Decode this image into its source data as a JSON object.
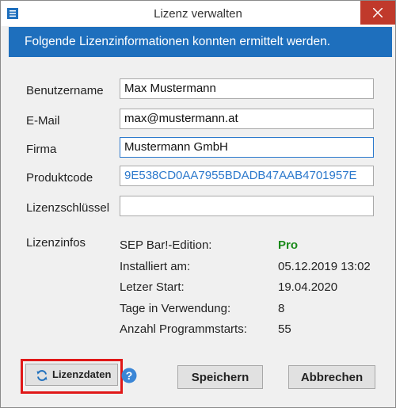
{
  "window": {
    "title": "Lizenz verwalten",
    "banner": "Folgende Lizenzinformationen konnten ermittelt werden."
  },
  "form": {
    "username_label": "Benutzername",
    "username_value": "Max Mustermann",
    "email_label": "E-Mail",
    "email_value": "max@mustermann.at",
    "company_label": "Firma",
    "company_value": "Mustermann GmbH",
    "product_code_label": "Produktcode",
    "product_code_value": "9E538CD0AA7955BDADB47AAB4701957E",
    "license_key_label": "Lizenzschlüssel",
    "license_key_value": ""
  },
  "license_info": {
    "section_label": "Lizenzinfos",
    "rows": [
      {
        "label": "SEP Bar!-Edition:",
        "value": "Pro"
      },
      {
        "label": "Installiert am:",
        "value": "05.12.2019 13:02"
      },
      {
        "label": "Letzer Start:",
        "value": "19.04.2020"
      },
      {
        "label": "Tage in Verwendung:",
        "value": "8"
      },
      {
        "label": "Anzahl Programmstarts:",
        "value": "55"
      }
    ]
  },
  "buttons": {
    "license_data": "Lizenzdaten",
    "save": "Speichern",
    "cancel": "Abbrechen"
  },
  "colors": {
    "banner": "#1e6fbd",
    "edition_pro": "#1a8a1a",
    "highlight": "#e01818",
    "close_button": "#c0392b"
  },
  "icons": {
    "app": "app-menu-icon",
    "close": "close-icon",
    "refresh": "refresh-icon",
    "help": "help-icon"
  }
}
